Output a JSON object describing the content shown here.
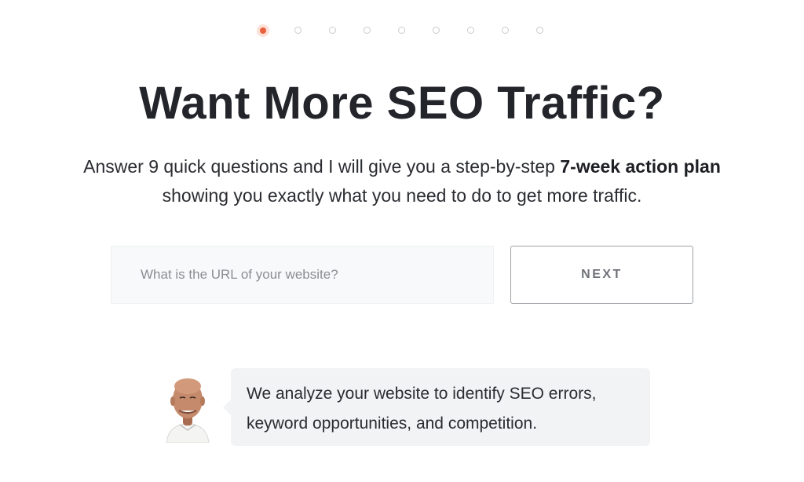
{
  "progress": {
    "total_steps": 9,
    "current_step": 1,
    "accent_color": "#e8603c"
  },
  "headline": "Want More SEO Traffic?",
  "subtext": {
    "before": "Answer 9 quick questions and I will give you a step-by-step ",
    "bold": "7-week action plan",
    "after": " showing you exactly what you need to do to get more traffic."
  },
  "form": {
    "url_placeholder": "What is the URL of your website?",
    "url_value": "",
    "next_label": "NEXT"
  },
  "testimonial": {
    "avatar_icon": "person-avatar",
    "message": "We analyze your website to identify SEO errors, keyword opportunities, and competition."
  }
}
